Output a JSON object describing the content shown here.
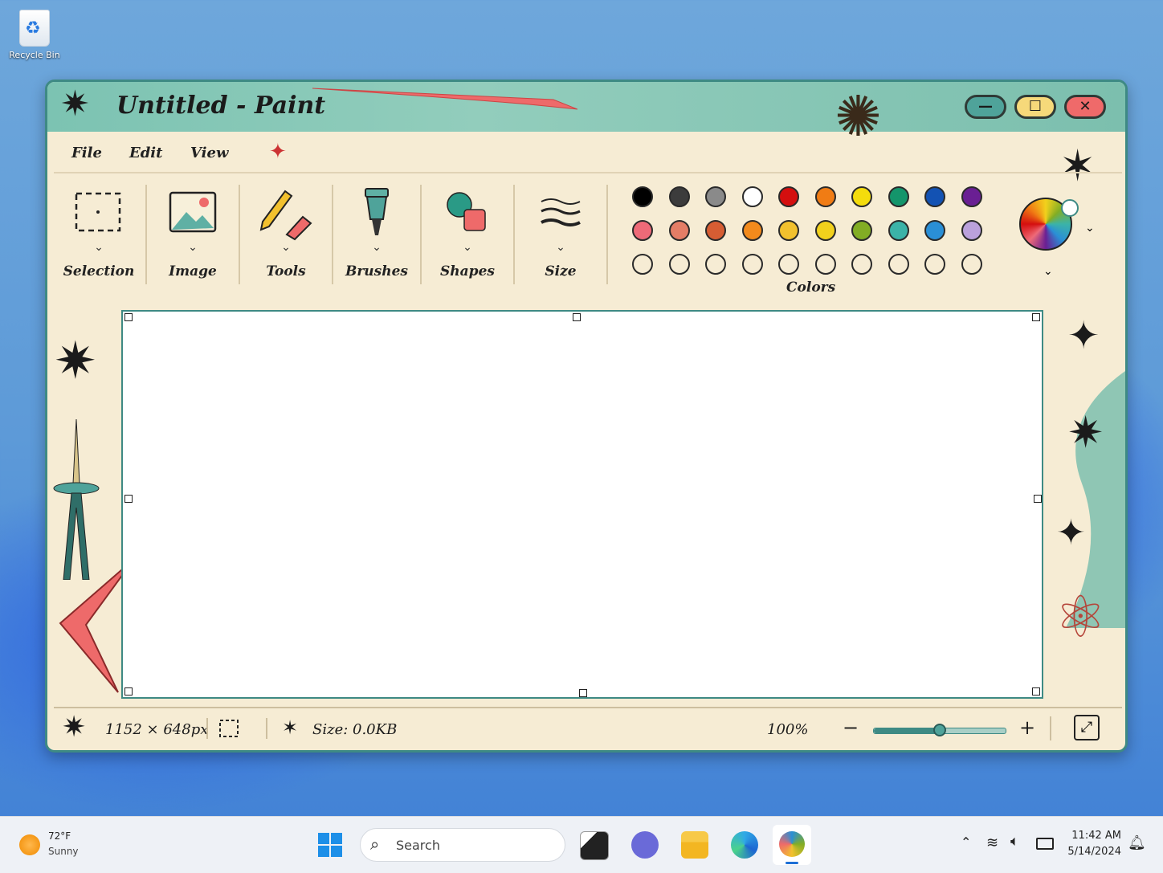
{
  "desktop": {
    "recycle_bin_label": "Recycle Bin"
  },
  "window": {
    "title": "Untitled - Paint",
    "controls": {
      "minimize": "—",
      "maximize": "☐",
      "close": "✕"
    }
  },
  "menu": {
    "items": [
      "File",
      "Edit",
      "View"
    ]
  },
  "ribbon": {
    "groups": [
      {
        "label": "Selection",
        "icon": "selection-icon"
      },
      {
        "label": "Image",
        "icon": "image-icon"
      },
      {
        "label": "Tools",
        "icon": "pencil-eraser-icon"
      },
      {
        "label": "Brushes",
        "icon": "brush-icon"
      },
      {
        "label": "Shapes",
        "icon": "shapes-icon"
      },
      {
        "label": "Size",
        "icon": "size-lines-icon"
      }
    ],
    "colors_label": "Colors",
    "palette_row1": [
      "#000000",
      "#3c3c3c",
      "#8a8a8a",
      "#ffffff",
      "#d40f0f",
      "#f07c14",
      "#f4dc0c",
      "#14956b",
      "#1352b3",
      "#6a1f93"
    ],
    "palette_row2": [
      "#ee6a78",
      "#e47d66",
      "#d65d33",
      "#f28a1c",
      "#f2c12e",
      "#f2d11c",
      "#82ad24",
      "#3bb3a8",
      "#2a8fd6",
      "#bba1dc"
    ],
    "palette_row3": [
      "#f6ecd4",
      "#f6ecd4",
      "#f6ecd4",
      "#f6ecd4",
      "#f6ecd4",
      "#f6ecd4",
      "#f6ecd4",
      "#f6ecd4",
      "#f6ecd4",
      "#f6ecd4"
    ]
  },
  "status": {
    "dimensions": "1152 × 648px",
    "size": "Size: 0.0KB",
    "zoom": "100%",
    "zoom_minus": "−",
    "zoom_plus": "+",
    "zoom_level": 0.5
  },
  "taskbar": {
    "weather_temp": "72°F",
    "weather_desc": "Sunny",
    "search_placeholder": "Search",
    "time": "11:42 AM",
    "date": "5/14/2024"
  }
}
